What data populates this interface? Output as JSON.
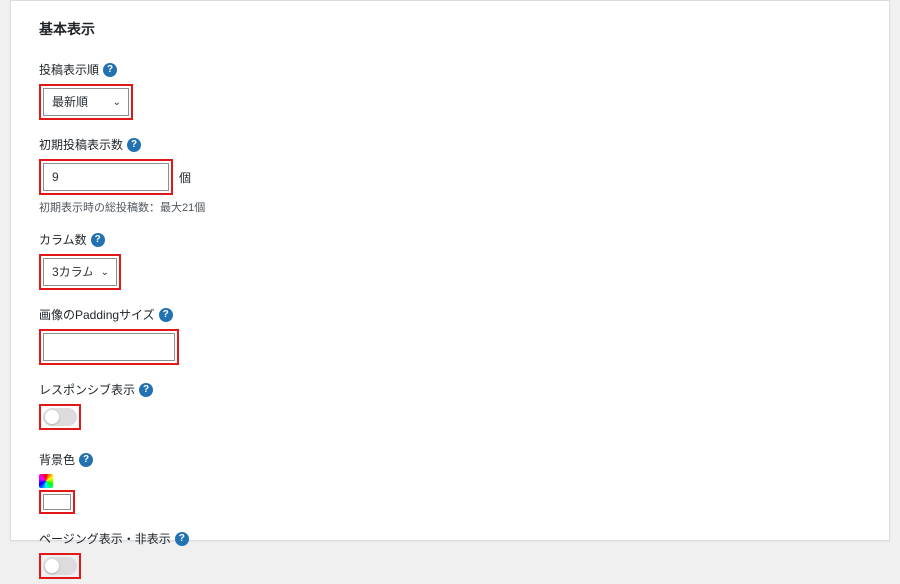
{
  "section": {
    "title": "基本表示"
  },
  "fields": {
    "order": {
      "label": "投稿表示順",
      "value": "最新順"
    },
    "initial_count": {
      "label": "初期投稿表示数",
      "value": "9",
      "suffix": "個",
      "hint": "初期表示時の総投稿数：最大21個"
    },
    "columns": {
      "label": "カラム数",
      "value": "3カラム"
    },
    "padding": {
      "label": "画像のPaddingサイズ",
      "value": ""
    },
    "responsive": {
      "label": "レスポンシブ表示"
    },
    "bgcolor": {
      "label": "背景色"
    },
    "paging": {
      "label": "ページング表示・非表示"
    }
  },
  "icons": {
    "help": "?"
  }
}
